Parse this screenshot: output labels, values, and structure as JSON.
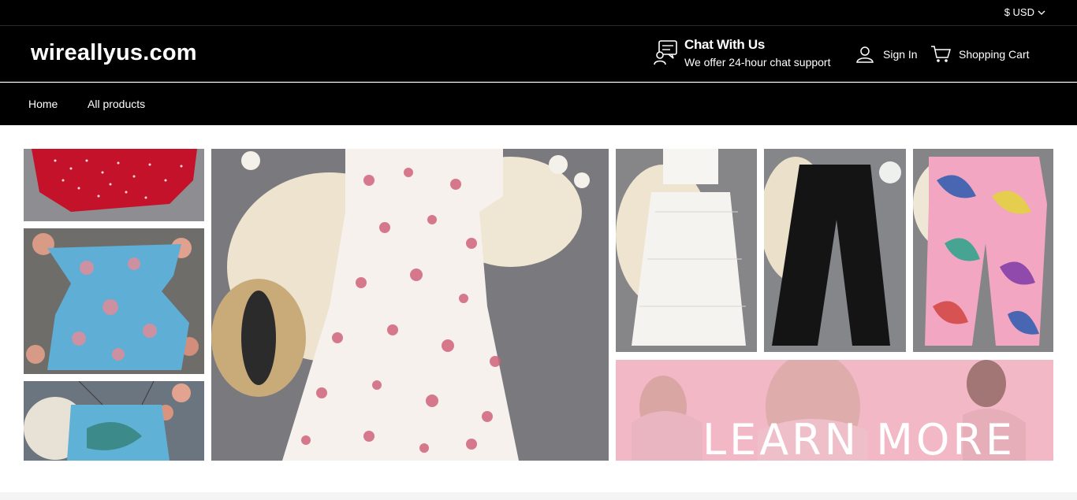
{
  "topbar": {
    "currency": "$ USD"
  },
  "header": {
    "logo": "wireallyus.com",
    "chat": {
      "title": "Chat With Us",
      "subtitle": "We offer 24-hour chat support"
    },
    "sign_in": "Sign In",
    "cart": "Shopping Cart"
  },
  "nav": {
    "items": [
      {
        "label": "Home"
      },
      {
        "label": "All products"
      }
    ]
  },
  "banner": {
    "learn_more": "LEARN MORE"
  },
  "colors": {
    "header_bg": "#000000",
    "text": "#ffffff",
    "learn_more_bg": "#f2b8c6"
  },
  "icons": [
    "chevron-down-icon",
    "chat-icon",
    "user-icon",
    "cart-icon"
  ]
}
